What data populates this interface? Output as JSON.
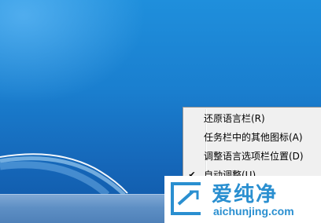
{
  "context_menu": {
    "items": [
      {
        "label": "还原语言栏(R)",
        "checked": false
      },
      {
        "label": "任务栏中的其他图标(A)",
        "checked": false
      },
      {
        "label": "调整语言选项栏位置(D)",
        "checked": false
      },
      {
        "label": "自动调整(U)",
        "checked": true
      }
    ],
    "check_glyph": "✔"
  },
  "watermark": {
    "title": "爱纯净",
    "url": "aichunjing.com"
  },
  "colors": {
    "desktop": "#1a7fcf",
    "menu_background": "#f0f0f0",
    "watermark_blue": "#2a8fd0"
  }
}
